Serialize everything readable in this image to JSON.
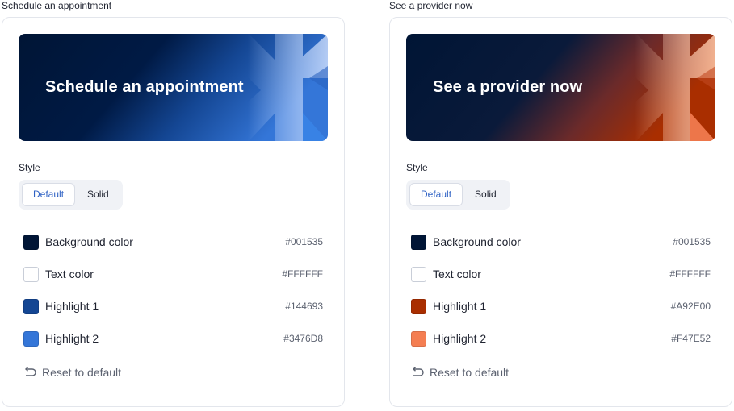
{
  "panels": [
    {
      "heading": "Schedule an appointment",
      "banner_text": "Schedule an appointment",
      "style_label": "Style",
      "style_options": [
        "Default",
        "Solid"
      ],
      "active_style": "Default",
      "colors": [
        {
          "label": "Background color",
          "hex": "#001535"
        },
        {
          "label": "Text color",
          "hex": "#FFFFFF"
        },
        {
          "label": "Highlight 1",
          "hex": "#144693"
        },
        {
          "label": "Highlight 2",
          "hex": "#3476D8"
        }
      ],
      "reset_label": "Reset to default"
    },
    {
      "heading": "See a provider now",
      "banner_text": "See a provider now",
      "style_label": "Style",
      "style_options": [
        "Default",
        "Solid"
      ],
      "active_style": "Default",
      "colors": [
        {
          "label": "Background color",
          "hex": "#001535"
        },
        {
          "label": "Text color",
          "hex": "#FFFFFF"
        },
        {
          "label": "Highlight 1",
          "hex": "#A92E00"
        },
        {
          "label": "Highlight 2",
          "hex": "#F47E52"
        }
      ],
      "reset_label": "Reset to default"
    }
  ]
}
